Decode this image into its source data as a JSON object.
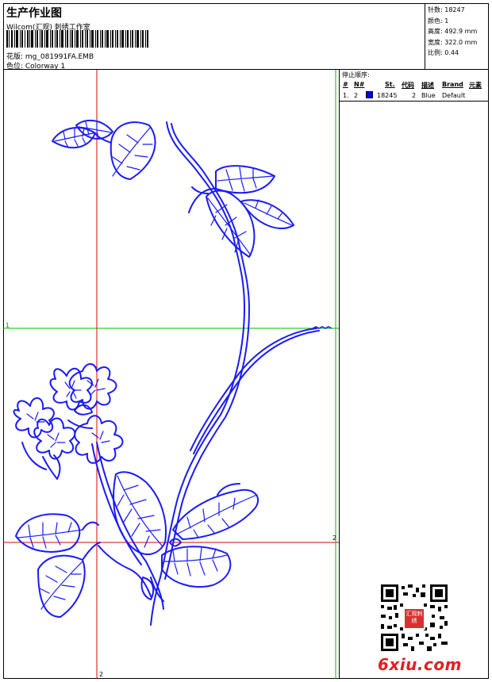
{
  "header": {
    "title": "生产作业图",
    "studio": "Wilcom(汇观) 刺绣工作室",
    "design": "花版: mg_081991FA.EMB",
    "colorway": "色位: Colorway 1"
  },
  "specs": {
    "stitches": "针数: 18247",
    "colors": "颜色: 1",
    "height": "高度: 492.9 mm",
    "width": "宽度: 322.0 mm",
    "ratio": "比例: 0.44"
  },
  "stop_sequence": {
    "title": "停止顺序:",
    "headers": [
      "#",
      "N#",
      "St.",
      "代码",
      "描述",
      "Brand",
      "元素"
    ],
    "rows": [
      {
        "index": "1.",
        "needle": "2",
        "color_hex": "#0000ff",
        "stitches": "18245",
        "code": "2",
        "description": "Blue",
        "brand": "Default",
        "elements": ""
      }
    ]
  },
  "guides": {
    "horizontal_1_label": "1",
    "horizontal_2_label": "2",
    "vertical_2_label": "2",
    "horizontal_color": "#00c000",
    "vertical_color": "#e00000"
  },
  "colors": {
    "thread": "#1a1aff",
    "watermark": "#e02020"
  },
  "qr": {
    "stamp_text": "汇观刺绣"
  },
  "watermark": "6xiu.com"
}
